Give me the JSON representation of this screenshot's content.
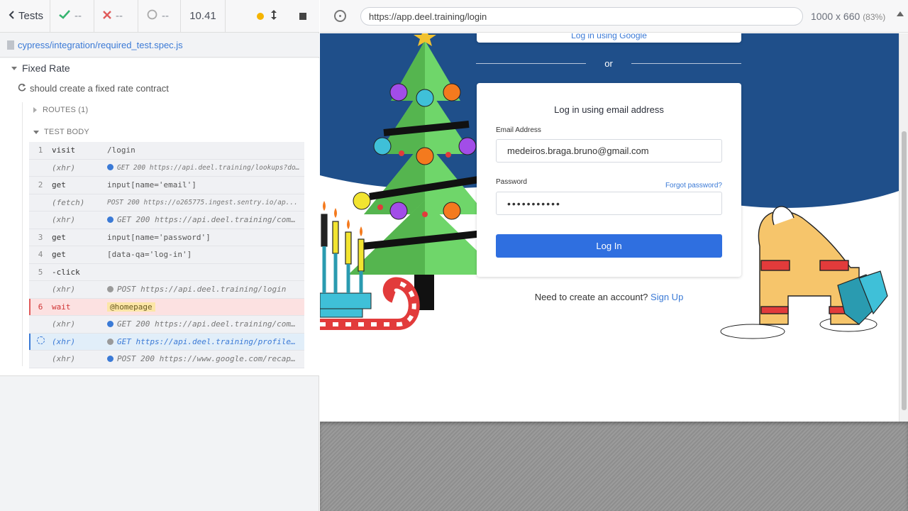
{
  "reporter": {
    "tests_label": "Tests",
    "passed": "--",
    "failed": "--",
    "pending": "--",
    "duration": "10.41",
    "spec_path": "cypress/integration/required_test.spec.js",
    "suite_title": "Fixed Rate",
    "test_title": "should create a fixed rate contract",
    "routes_label": "ROUTES (1)",
    "test_body_label": "TEST BODY",
    "commands": [
      {
        "num": "1",
        "name": "visit",
        "message": "/login",
        "type": "cmd"
      },
      {
        "num": "",
        "name": "(xhr)",
        "message": "GET 200 https://api.deel.training/lookups?do...",
        "type": "sub-small",
        "dot": "#3b7ad6"
      },
      {
        "num": "2",
        "name": "get",
        "message": "input[name='email']",
        "type": "cmd"
      },
      {
        "num": "",
        "name": "(fetch)",
        "message": "POST 200 https://o265775.ingest.sentry.io/ap...",
        "type": "sub-small"
      },
      {
        "num": "",
        "name": "(xhr)",
        "message": "GET 200 https://api.deel.training/com...",
        "type": "sub",
        "dot": "#3b7ad6"
      },
      {
        "num": "3",
        "name": "get",
        "message": "input[name='password']",
        "type": "cmd"
      },
      {
        "num": "4",
        "name": "get",
        "message": "[data-qa='log-in']",
        "type": "cmd"
      },
      {
        "num": "5",
        "name": "-click",
        "message": "",
        "type": "cmd"
      },
      {
        "num": "",
        "name": "(xhr)",
        "message": "POST https://api.deel.training/login",
        "type": "sub",
        "dot": "#9a9a9a"
      },
      {
        "num": "6",
        "name": "wait",
        "message": "@homepage",
        "type": "failed"
      },
      {
        "num": "",
        "name": "(xhr)",
        "message": "GET 200 https://api.deel.training/com...",
        "type": "sub",
        "dot": "#3b7ad6"
      },
      {
        "num": "",
        "name": "(xhr)",
        "message": "GET https://api.deel.training/profile...",
        "type": "active",
        "dot": "#9a9a9a"
      },
      {
        "num": "",
        "name": "(xhr)",
        "message": "POST 200 https://www.google.com/recap...",
        "type": "sub",
        "dot": "#3b7ad6"
      }
    ]
  },
  "browser": {
    "url": "https://app.deel.training/login",
    "viewport": "1000 x 660",
    "scale": "(83%)"
  },
  "app": {
    "google_button": "Log in using Google",
    "or_label": "or",
    "login_title": "Log in using email address",
    "email_label": "Email Address",
    "email_value": "medeiros.braga.bruno@gmail.com",
    "password_label": "Password",
    "password_value": "•••••••••••",
    "forgot_password": "Forgot password?",
    "login_button": "Log In",
    "signup_prompt": "Need to create an account?",
    "signup_link": "Sign Up"
  },
  "colors": {
    "accent": "#3b7ad6",
    "sky": "#1f4f8a",
    "failed": "#d03434",
    "login_button": "#2f6fe0"
  }
}
